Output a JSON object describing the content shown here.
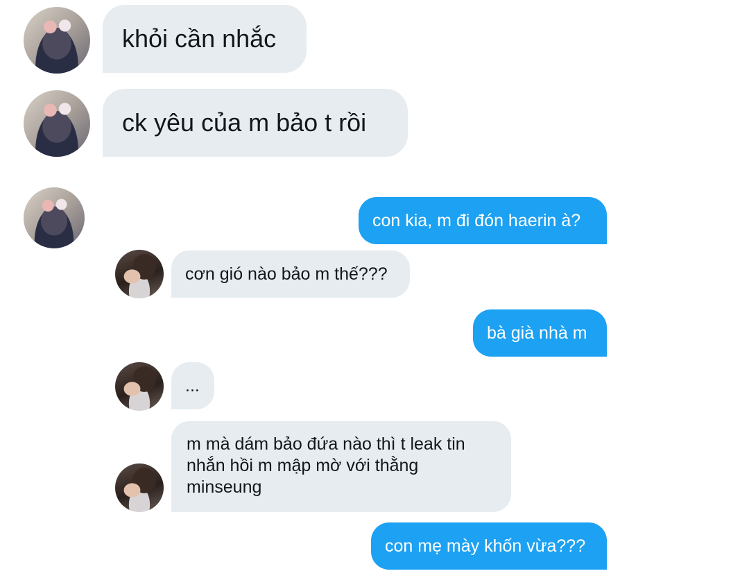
{
  "conversation": {
    "outer_messages": [
      {
        "sender": "left",
        "text": "khỏi cần nhắc"
      },
      {
        "sender": "left",
        "text": "ck yêu của m bảo t rồi"
      }
    ],
    "quoted_messages": [
      {
        "sender": "right",
        "text": "con kia, m đi đón haerin à?"
      },
      {
        "sender": "left",
        "text": "cơn gió nào bảo m thế???"
      },
      {
        "sender": "right",
        "text": "bà già nhà m"
      },
      {
        "sender": "left",
        "text": "..."
      },
      {
        "sender": "left",
        "text": "m mà dám bảo đứa nào thì t leak tin nhắn hồi m mập mờ với thằng minseung"
      },
      {
        "sender": "right",
        "text": "con mẹ mày khốn vừa???"
      }
    ]
  },
  "colors": {
    "sent_bubble": "#1da1f2",
    "received_bubble": "#e6ecf0",
    "background": "#ffffff"
  }
}
